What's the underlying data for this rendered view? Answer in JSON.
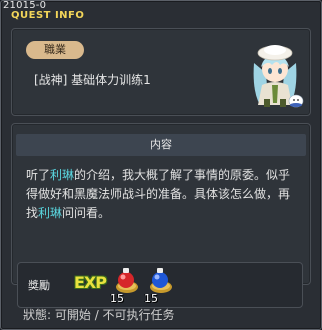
{
  "header": {
    "code": "21015-0",
    "title": "QUEST INFO"
  },
  "job": {
    "tag": "職業",
    "text": "[战神] 基础体力训练1"
  },
  "content": {
    "heading": "内容",
    "line1_a": "听了",
    "line1_hl": "利琳",
    "line1_b": "的介绍，我大概了解了事情的原委。似乎",
    "line2": "得做好和黑魔法师战斗的准备。具体该怎么做，再",
    "line3_a": "找",
    "line3_hl": "利琳",
    "line3_b": "问问看。"
  },
  "reward": {
    "label": "獎勵",
    "exp_label": "EXP",
    "items": [
      {
        "icon": "red-potion-icon",
        "qty": "15"
      },
      {
        "icon": "blue-potion-icon",
        "qty": "15"
      }
    ]
  },
  "status": {
    "label": "狀態:",
    "value": "可開始 / 不可执行任务"
  },
  "colors": {
    "title": "#f3d65a",
    "highlight": "#5ad7e0",
    "tag": "#d9b98d"
  }
}
